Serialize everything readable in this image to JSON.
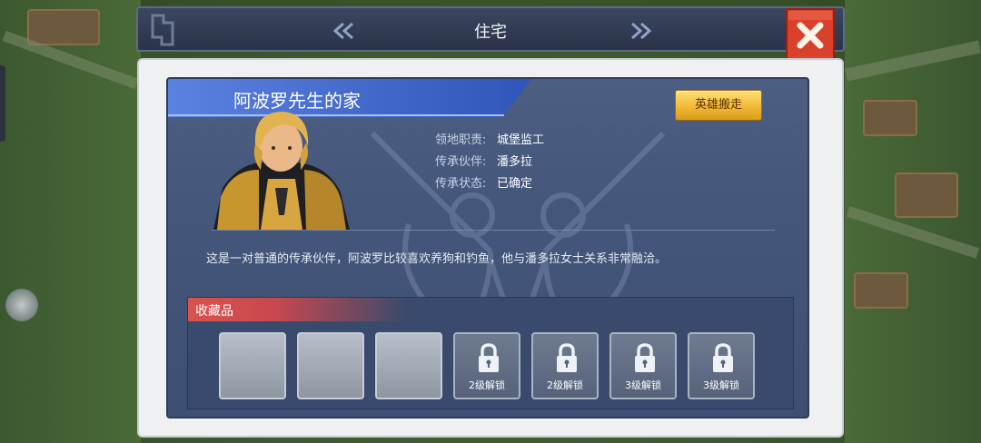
{
  "window": {
    "title": "住宅",
    "prev_icon": "double-chevron-left-icon",
    "next_icon": "double-chevron-right-icon",
    "close_icon": "close-x-icon"
  },
  "house": {
    "name": "阿波罗先生的家",
    "move_button": "英雄搬走",
    "info": [
      {
        "key": "领地职责:",
        "value": "城堡监工"
      },
      {
        "key": "传承伙伴:",
        "value": "潘多拉"
      },
      {
        "key": "传承状态:",
        "value": "已确定"
      }
    ],
    "description": "这是一对普通的传承伙伴，阿波罗比较喜欢养狗和钓鱼，他与潘多拉女士关系非常融洽。"
  },
  "collection": {
    "title": "收藏品",
    "slots": [
      {
        "state": "empty"
      },
      {
        "state": "empty"
      },
      {
        "state": "empty"
      },
      {
        "state": "locked",
        "label": "2级解锁"
      },
      {
        "state": "locked",
        "label": "2级解锁"
      },
      {
        "state": "locked",
        "label": "3级解锁"
      },
      {
        "state": "locked",
        "label": "3级解锁"
      }
    ]
  },
  "colors": {
    "accent_gold": "#f2b935",
    "close_red": "#d9412b",
    "panel_blue": "#44567a",
    "banner_blue": "#3a64c8"
  }
}
